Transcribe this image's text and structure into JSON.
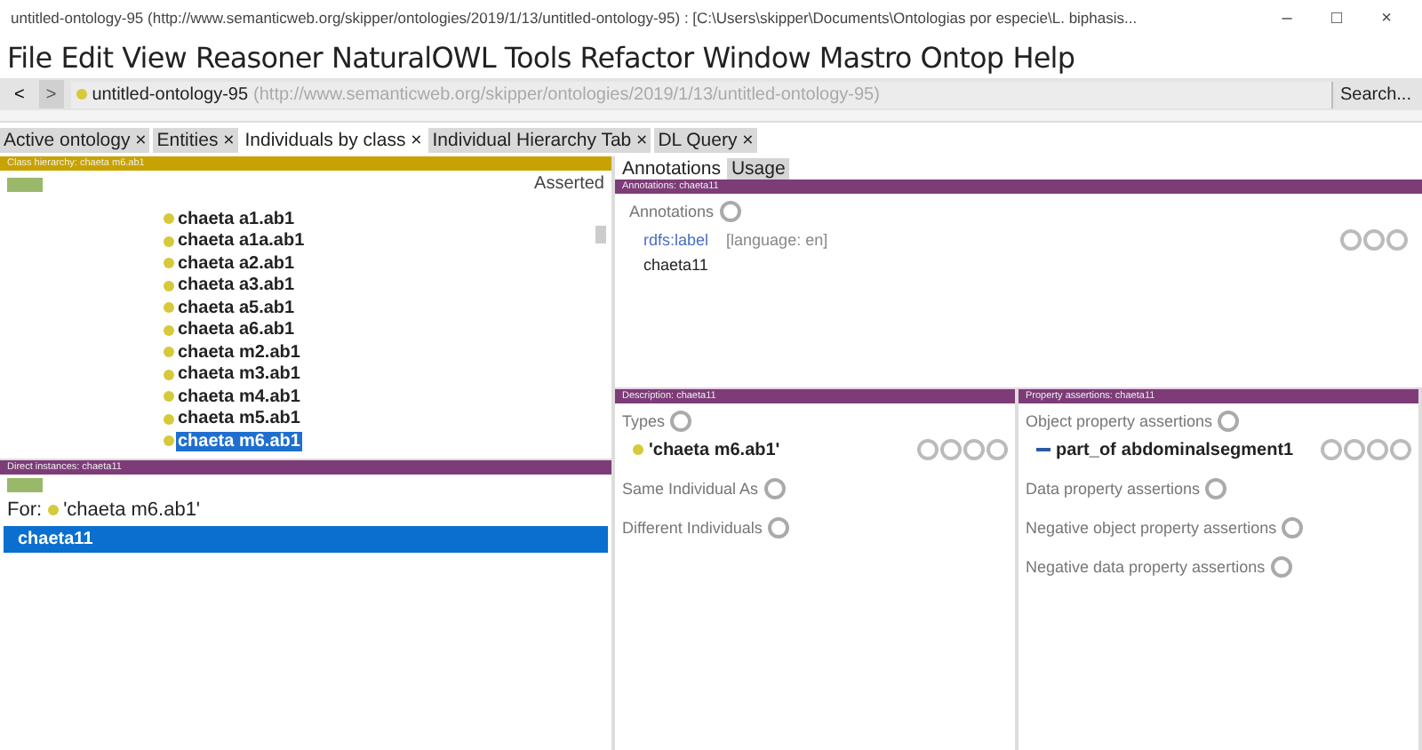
{
  "window": {
    "title": "untitled-ontology-95 (http://www.semanticweb.org/skipper/ontologies/2019/1/13/untitled-ontology-95)  : [C:\\Users\\skipper\\Documents\\Ontologias por especie\\L. biphasis...",
    "controls": [
      "–",
      "□",
      "×"
    ]
  },
  "menu": [
    "File",
    "Edit",
    "View",
    "Reasoner",
    "NaturalOWL",
    "Tools",
    "Refactor",
    "Window",
    "Mastro",
    "Ontop",
    "Help"
  ],
  "address_bar": {
    "back": "<",
    "forward": ">",
    "ontology": "untitled-ontology-95",
    "iri": "(http://www.semanticweb.org/skipper/ontologies/2019/1/13/untitled-ontology-95)",
    "search": "Search..."
  },
  "tabs": [
    {
      "label": "Active ontology",
      "close": "×",
      "selected": false
    },
    {
      "label": "Entities",
      "close": "×",
      "selected": false
    },
    {
      "label": "Individuals by class",
      "close": "×",
      "selected": true
    },
    {
      "label": "Individual Hierarchy Tab",
      "close": "×",
      "selected": false
    },
    {
      "label": "DL Query",
      "close": "×",
      "selected": false
    }
  ],
  "class_hierarchy": {
    "header": "Class hierarchy: chaeta m6.ab1",
    "mode": "Asserted",
    "items": [
      {
        "label": "chaeta a1.ab1",
        "selected": false
      },
      {
        "label": "chaeta a1a.ab1",
        "selected": false
      },
      {
        "label": "chaeta a2.ab1",
        "selected": false
      },
      {
        "label": "chaeta a3.ab1",
        "selected": false
      },
      {
        "label": "chaeta a5.ab1",
        "selected": false
      },
      {
        "label": "chaeta a6.ab1",
        "selected": false
      },
      {
        "label": "chaeta m2.ab1",
        "selected": false
      },
      {
        "label": "chaeta m3.ab1",
        "selected": false
      },
      {
        "label": "chaeta m4.ab1",
        "selected": false
      },
      {
        "label": "chaeta m5.ab1",
        "selected": false
      },
      {
        "label": "chaeta m6.ab1",
        "selected": true
      }
    ]
  },
  "direct_instances": {
    "header": "Direct instances: chaeta11",
    "for_label": "For:",
    "for_value": "'chaeta m6.ab1'",
    "items": [
      {
        "label": "chaeta11",
        "selected": true
      }
    ]
  },
  "right_tabs": [
    {
      "label": "Annotations",
      "selected": true
    },
    {
      "label": "Usage",
      "selected": false
    }
  ],
  "annotations": {
    "header": "Annotations: chaeta11",
    "heading": "Annotations",
    "rows": [
      {
        "property": "rdfs:label",
        "language": "[language: en]",
        "value": "chaeta11"
      }
    ]
  },
  "description": {
    "header": "Description: chaeta11",
    "sections": [
      {
        "heading": "Types",
        "items": [
          "'chaeta m6.ab1'"
        ]
      },
      {
        "heading": "Same Individual As"
      },
      {
        "heading": "Different Individuals"
      }
    ]
  },
  "property_assertions": {
    "header": "Property assertions: chaeta11",
    "sections": [
      {
        "heading": "Object property assertions",
        "items": [
          {
            "property": "part_of",
            "value": "abdominalsegment1"
          }
        ]
      },
      {
        "heading": "Data property assertions"
      },
      {
        "heading": "Negative object property assertions"
      },
      {
        "heading": "Negative data property assertions"
      }
    ]
  }
}
